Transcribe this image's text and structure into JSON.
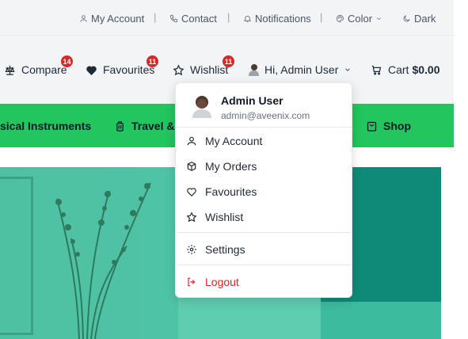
{
  "topbar": {
    "my_account": "My Account",
    "contact": "Contact",
    "notifications": "Notifications",
    "color": "Color",
    "dark": "Dark",
    "separator": "|"
  },
  "navbar": {
    "compare": "Compare",
    "compare_count": "14",
    "favourites": "Favourites",
    "favourites_count": "11",
    "wishlist": "Wishlist",
    "wishlist_count": "11",
    "greeting": "Hi, Admin User",
    "cart_label": "Cart",
    "cart_total": "$0.00"
  },
  "categories": {
    "musical": "sical Instruments",
    "travel": "Travel &",
    "shop": "Shop"
  },
  "user_menu": {
    "name": "Admin User",
    "email": "admin@aveenix.com",
    "items": [
      {
        "label": "My Account",
        "icon": "user-icon"
      },
      {
        "label": "My Orders",
        "icon": "package-icon"
      },
      {
        "label": "Favourites",
        "icon": "heart-icon"
      },
      {
        "label": "Wishlist",
        "icon": "star-icon"
      }
    ],
    "settings": "Settings",
    "logout": "Logout"
  },
  "colors": {
    "accent_green": "#22c55e",
    "badge_red": "#dc2626",
    "logout_red": "#dc2626"
  }
}
